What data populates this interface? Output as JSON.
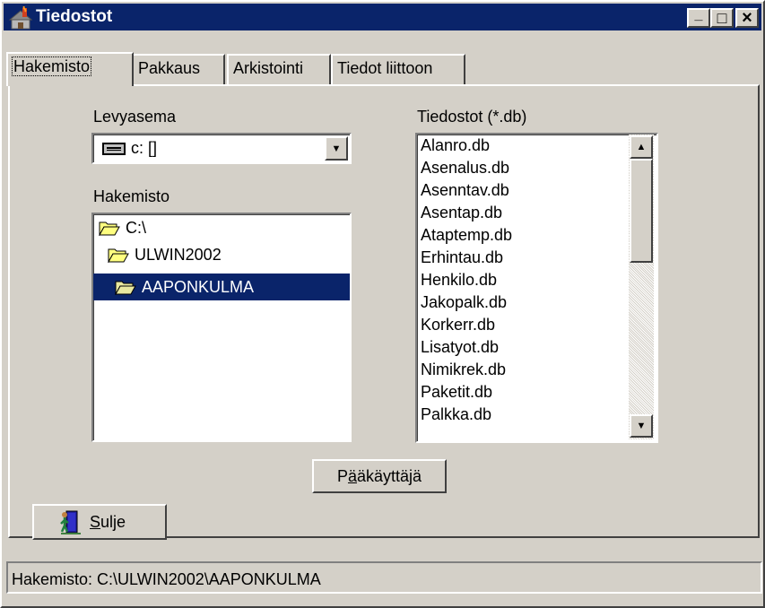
{
  "window": {
    "title": "Tiedostot",
    "controls": {
      "minimize": "_",
      "maximize": "□",
      "close": "×"
    }
  },
  "tabs": [
    "Hakemisto",
    "Pakkaus",
    "Arkistointi",
    "Tiedot liittoon"
  ],
  "drive": {
    "label": "Levyasema",
    "value": "c: []"
  },
  "directory": {
    "label": "Hakemisto",
    "items": [
      "C:\\",
      "ULWIN2002",
      "AAPONKULMA"
    ],
    "selected": "AAPONKULMA"
  },
  "files": {
    "label": "Tiedostot (*.db)",
    "items": [
      "Alanro.db",
      "Asenalus.db",
      "Asenntav.db",
      "Asentap.db",
      "Ataptemp.db",
      "Erhintau.db",
      "Henkilo.db",
      "Jakopalk.db",
      "Korkerr.db",
      "Lisatyot.db",
      "Nimikrek.db",
      "Paketit.db",
      "Palkka.db"
    ]
  },
  "buttons": {
    "admin": {
      "prefix": "P",
      "mnemonic": "ä",
      "rest": "äkäyttäjä"
    },
    "close": {
      "mnemonic": "S",
      "rest": "ulje"
    }
  },
  "status": "Hakemisto: C:\\ULWIN2002\\AAPONKULMA",
  "colors": {
    "titlebar": "#0a246a",
    "face": "#d4d0c8",
    "selection": "#0a246a"
  }
}
